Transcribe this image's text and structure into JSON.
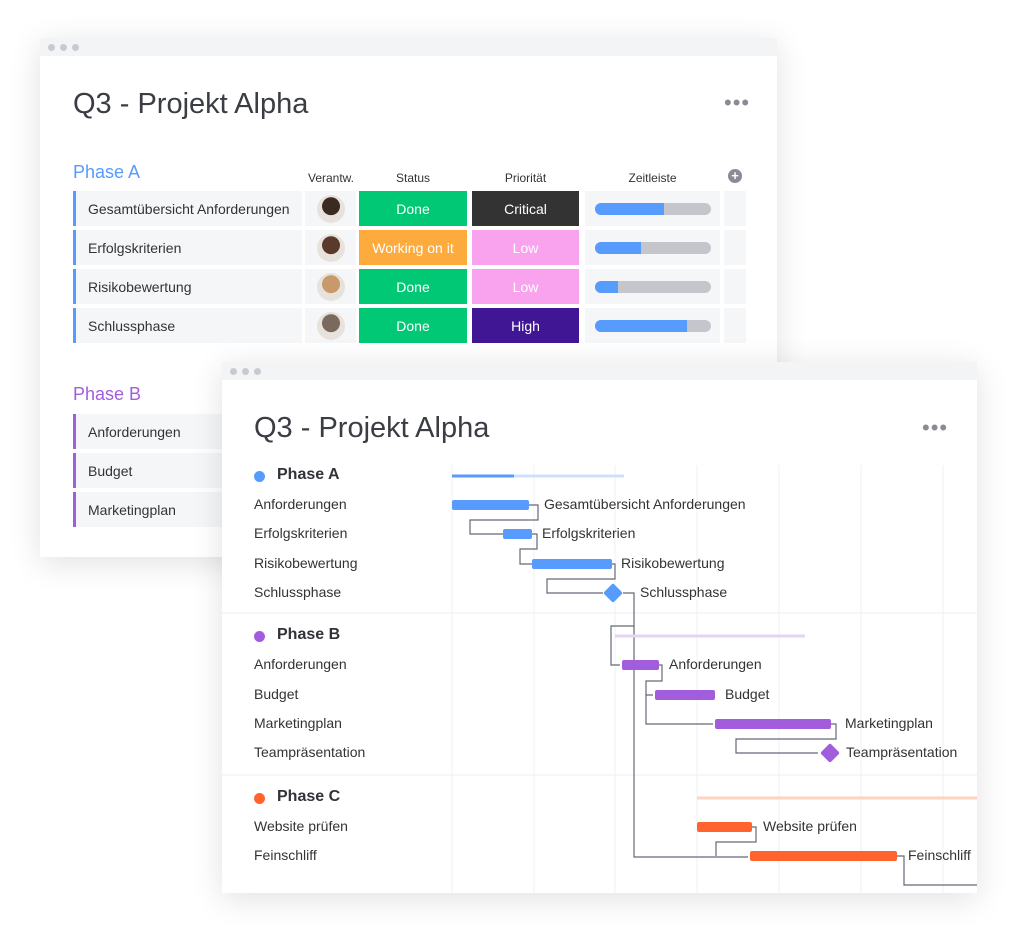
{
  "board": {
    "title": "Q3 - Projekt Alpha",
    "more_icon": "ellipsis-icon",
    "columns": {
      "owner": "Verantw.",
      "status": "Status",
      "priority": "Priorität",
      "timeline": "Zeitleiste"
    },
    "add_column_icon": "plus-circle-icon",
    "phase_a": {
      "label": "Phase A",
      "color": "#579bfc",
      "rows": [
        {
          "name": "Gesamtübersicht Anforderungen",
          "status": "Done",
          "status_color": "#00c875",
          "priority": "Critical",
          "priority_color": "#333333",
          "progress": 0.6,
          "avatar_color": "#3a2a22"
        },
        {
          "name": "Erfolgskriterien",
          "status": "Working on it",
          "status_color": "#fdab3d",
          "priority": "Low",
          "priority_color": "#f9a3ef",
          "progress": 0.4,
          "avatar_color": "#5a3b2b"
        },
        {
          "name": "Risikobewertung",
          "status": "Done",
          "status_color": "#00c875",
          "priority": "Low",
          "priority_color": "#f9a3ef",
          "progress": 0.2,
          "avatar_color": "#c89a6b"
        },
        {
          "name": "Schlussphase",
          "status": "Done",
          "status_color": "#00c875",
          "priority": "High",
          "priority_color": "#401694",
          "progress": 0.8,
          "avatar_color": "#7a6a5e"
        }
      ]
    },
    "phase_b": {
      "label": "Phase B",
      "color": "#a25ddc",
      "rows": [
        {
          "name": "Anforderungen"
        },
        {
          "name": "Budget"
        },
        {
          "name": "Marketingplan"
        }
      ]
    }
  },
  "gantt": {
    "title": "Q3 - Projekt Alpha",
    "more_icon": "ellipsis-icon",
    "phases": [
      {
        "label": "Phase A",
        "color": "#579bfc",
        "tasks": [
          "Anforderungen",
          "Erfolgskriterien",
          "Risikobewertung",
          "Schlussphase"
        ],
        "bar_labels": [
          "Gesamtübersicht Anforderungen",
          "Erfolgskriterien",
          "Risikobewertung",
          "Schlussphase"
        ]
      },
      {
        "label": "Phase B",
        "color": "#a25ddc",
        "tasks": [
          "Anforderungen",
          "Budget",
          "Marketingplan",
          "Teampräsentation"
        ],
        "bar_labels": [
          "Anforderungen",
          "Budget",
          "Marketingplan",
          "Teampräsentation"
        ]
      },
      {
        "label": "Phase C",
        "color": "#ff642e",
        "tasks": [
          "Website prüfen",
          "Feinschliff"
        ],
        "bar_labels": [
          "Website prüfen",
          "Feinschliff"
        ]
      }
    ]
  }
}
